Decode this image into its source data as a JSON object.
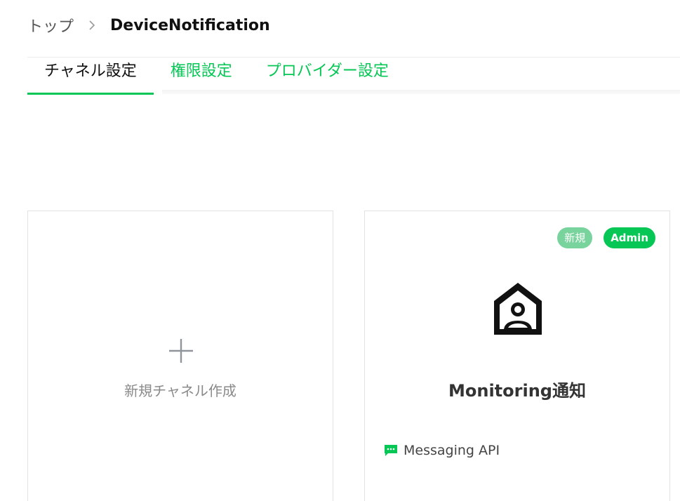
{
  "breadcrumb": {
    "top_label": "トップ",
    "separator": ">",
    "current_label": "DeviceNotification"
  },
  "tabs": [
    {
      "label": "チャネル設定",
      "active": true
    },
    {
      "label": "権限設定",
      "active": false
    },
    {
      "label": "プロバイダー設定",
      "active": false
    }
  ],
  "new_channel_card": {
    "icon": "plus-icon",
    "label": "新規チャネル作成"
  },
  "channel_card": {
    "badges": [
      "新規",
      "Admin"
    ],
    "icon": "monitoring-house-icon",
    "title": "Monitoring通知",
    "type_icon": "chat-bubble-icon",
    "type_label": "Messaging API"
  },
  "colors": {
    "accent": "#06c755",
    "badge_new": "#79d39c",
    "text_muted": "#8a8a8a"
  }
}
